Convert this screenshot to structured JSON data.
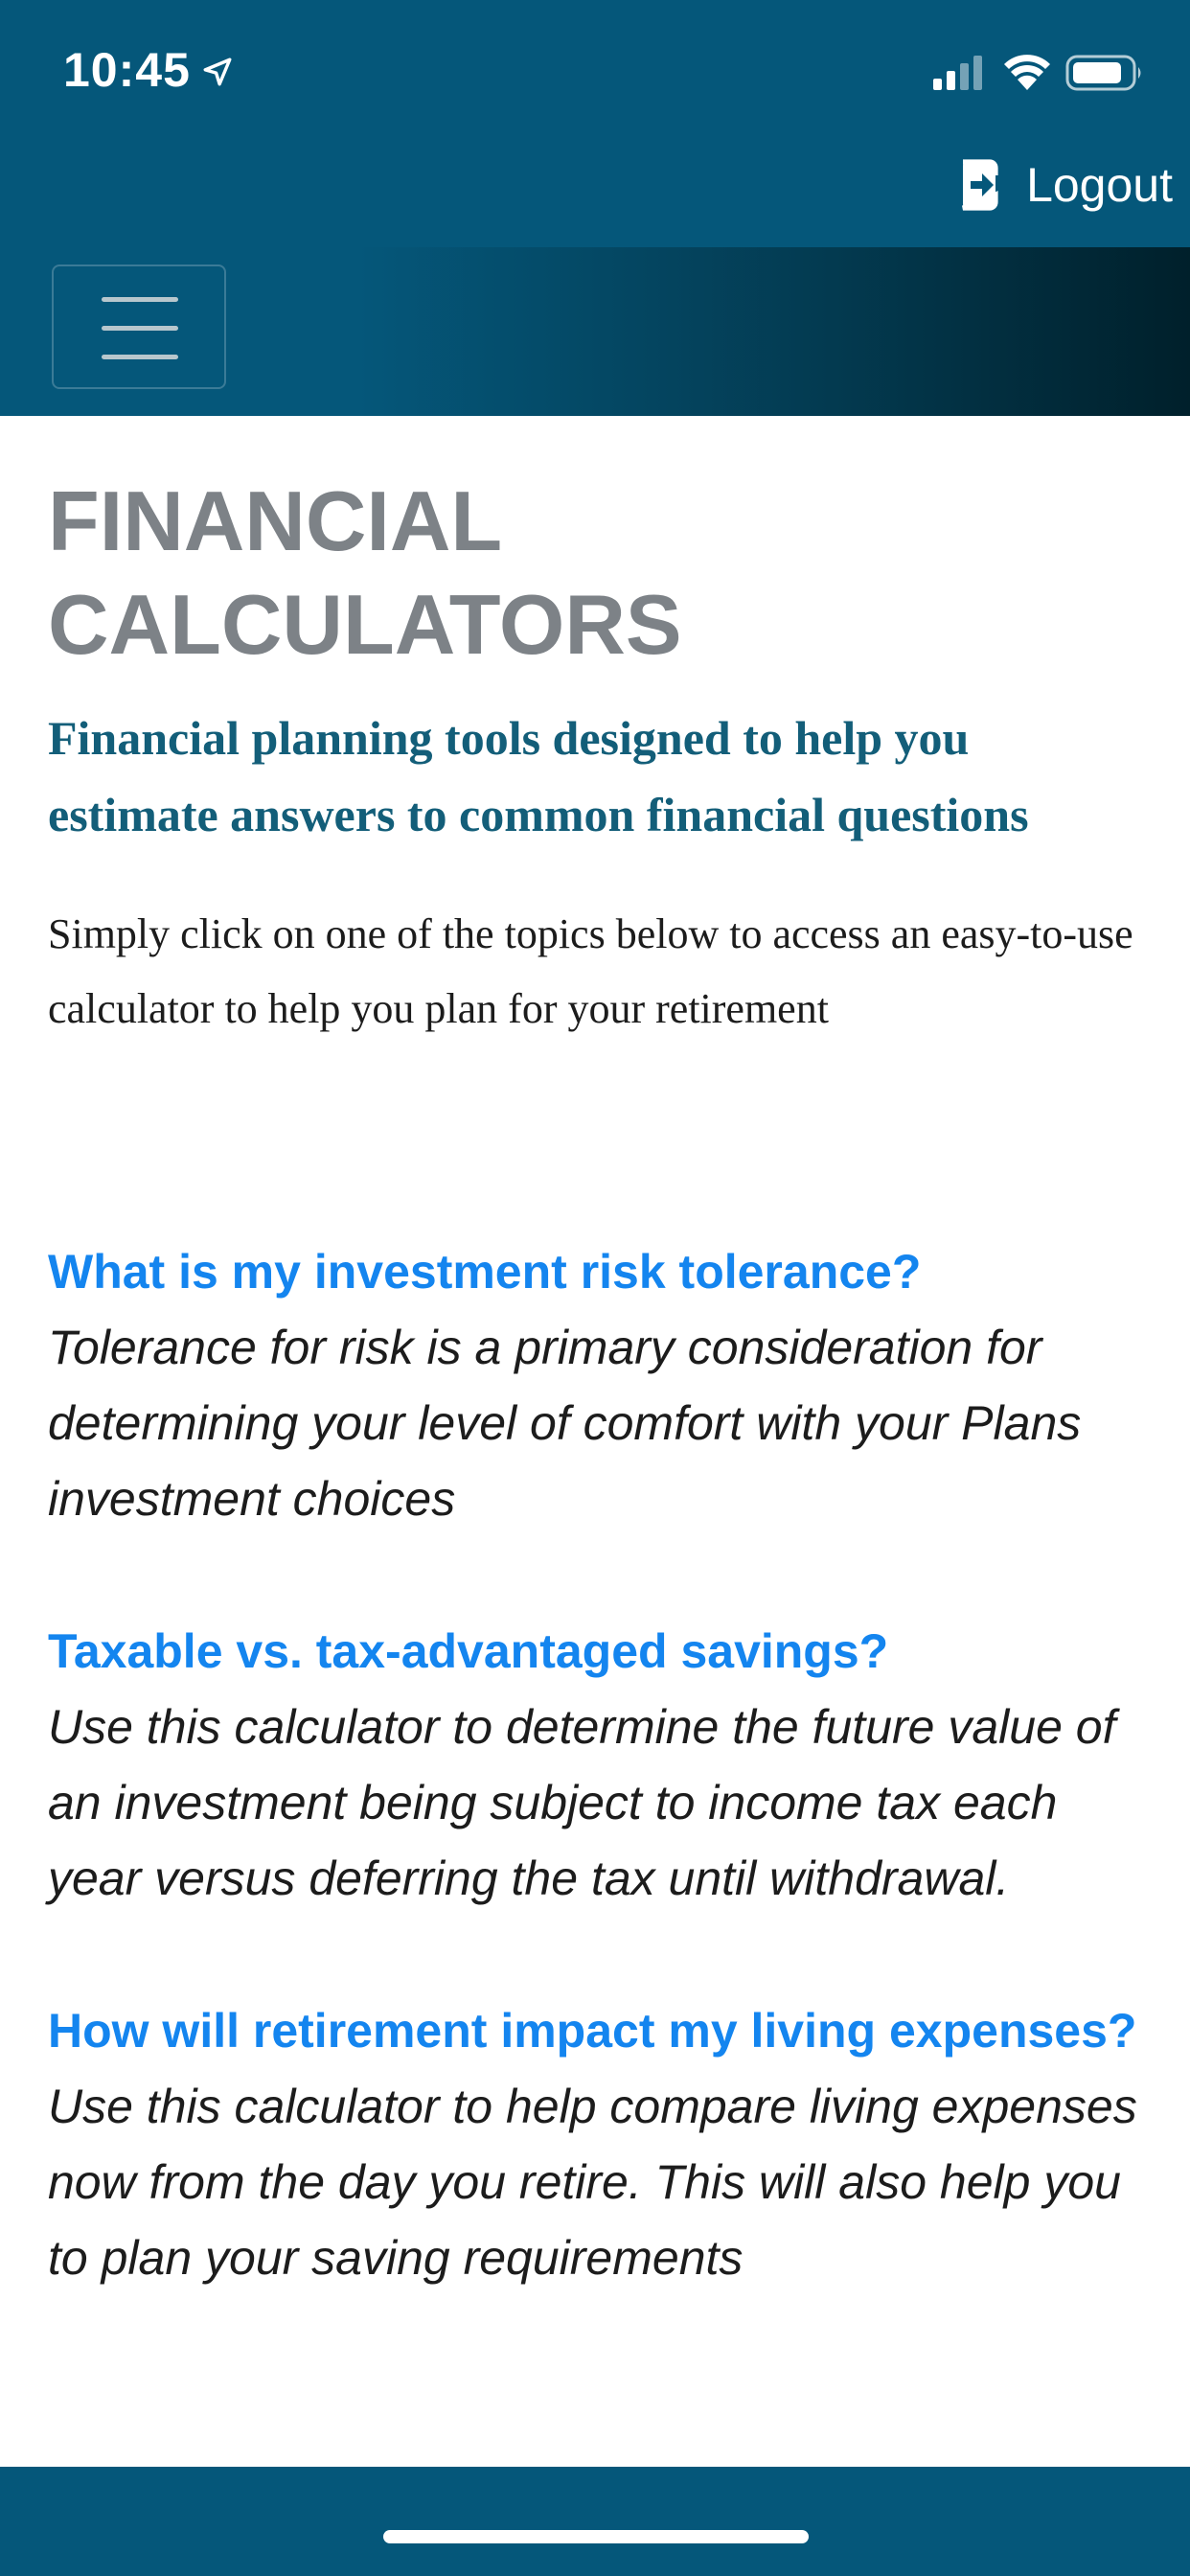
{
  "status_bar": {
    "time": "10:45",
    "icons": [
      "location-arrow-icon",
      "cellular-signal-icon",
      "wifi-icon",
      "battery-icon"
    ]
  },
  "header": {
    "logout_label": "Logout",
    "logout_icon": "logout-icon",
    "menu_icon": "hamburger-menu-icon"
  },
  "page": {
    "title": "FINANCIAL CALCULATORS",
    "subtitle": "Financial planning tools designed to help you estimate answers to common financial questions",
    "intro": "Simply click on one of the topics below to access an easy-to-use calculator to help you plan for your retirement"
  },
  "topics": [
    {
      "title": "What is my investment risk tolerance?",
      "description": "Tolerance for risk is a primary consideration for determining your level of comfort with your Plans investment choices"
    },
    {
      "title": "Taxable vs. tax-advantaged savings?",
      "description": "Use this calculator to determine the future value of an investment being subject to income tax each year versus deferring the tax until withdrawal."
    },
    {
      "title": "How will retirement impact my living expenses?",
      "description": "Use this calculator to help compare living expenses now from the day you retire. This will also help you to plan your saving requirements"
    }
  ],
  "colors": {
    "header_bg": "#05577a",
    "title_gray": "#7d8287",
    "subtitle_teal": "#135e79",
    "link_blue": "#1485ef",
    "body_text": "#1c1c1c"
  }
}
